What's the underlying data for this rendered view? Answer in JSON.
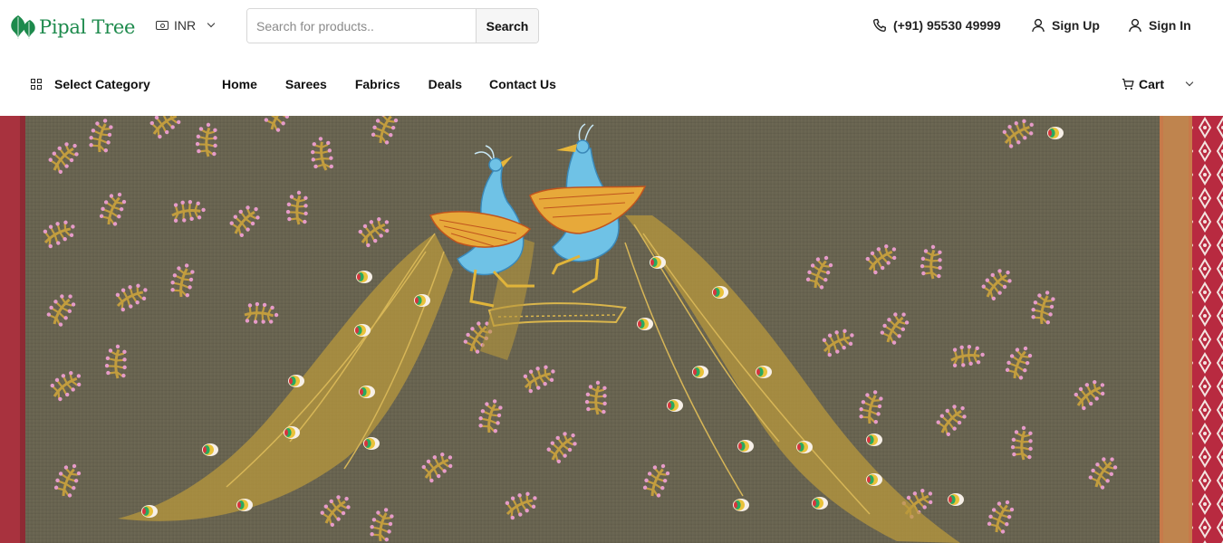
{
  "brand": {
    "name": "Pipal Tree"
  },
  "currency": {
    "selected": "INR"
  },
  "search": {
    "placeholder": "Search for products..",
    "button_label": "Search"
  },
  "contact": {
    "phone": "(+91) 95530 49999"
  },
  "account": {
    "sign_up": "Sign Up",
    "sign_in": "Sign In"
  },
  "nav": {
    "category_label": "Select Category",
    "items": [
      "Home",
      "Sarees",
      "Fabrics",
      "Deals",
      "Contact Us"
    ]
  },
  "cart": {
    "label": "Cart"
  },
  "colors": {
    "brand_green": "#1d8a4c",
    "fabric_base": "#6b6652",
    "border_red": "#b0283a",
    "thread_pink": "#ee9fd0",
    "thread_gold": "#c8a13e",
    "peacock_blue": "#6fc2e6"
  },
  "icons": {
    "logo": "pipal-leaf-icon",
    "currency": "cash-icon",
    "phone": "phone-icon",
    "user": "user-icon",
    "category": "grid-icon",
    "cart": "cart-icon",
    "dropdown": "chevron-down-icon"
  }
}
